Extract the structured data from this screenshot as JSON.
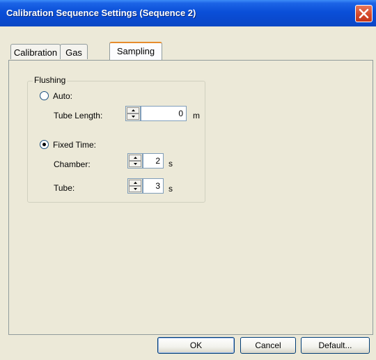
{
  "window": {
    "title": "Calibration Sequence Settings (Sequence 2)"
  },
  "tabs": [
    {
      "label": "Calibration",
      "active": false
    },
    {
      "label": "Gas",
      "active": false
    },
    {
      "label": "Sampling",
      "active": true
    }
  ],
  "flushing": {
    "label": "Flushing",
    "auto": {
      "label": "Auto:",
      "selected": false
    },
    "tube_length": {
      "label": "Tube Length:",
      "value": "0",
      "unit": "m"
    },
    "fixed_time": {
      "label": "Fixed Time:",
      "selected": true
    },
    "chamber": {
      "label": "Chamber:",
      "value": "2",
      "unit": "s"
    },
    "tube": {
      "label": "Tube:",
      "value": "3",
      "unit": "s"
    }
  },
  "buttons": {
    "ok": "OK",
    "cancel": "Cancel",
    "default": "Default..."
  },
  "colors": {
    "title_bar": "#0a4fd8",
    "close_button": "#d44a2b",
    "window_bg": "#ece9d8"
  },
  "icons": {
    "close": "close-icon",
    "spin_up": "spin-up-icon",
    "spin_down": "spin-down-icon"
  }
}
